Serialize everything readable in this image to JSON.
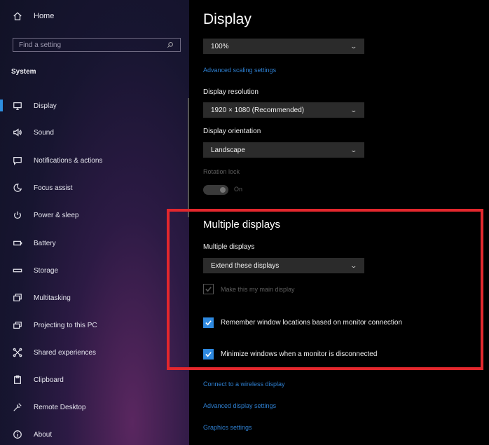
{
  "sidebar": {
    "home_label": "Home",
    "search_placeholder": "Find a setting",
    "section_title": "System",
    "items": [
      {
        "label": "Display",
        "icon": "monitor-icon"
      },
      {
        "label": "Sound",
        "icon": "speaker-icon"
      },
      {
        "label": "Notifications & actions",
        "icon": "message-icon"
      },
      {
        "label": "Focus assist",
        "icon": "moon-icon"
      },
      {
        "label": "Power & sleep",
        "icon": "power-icon"
      },
      {
        "label": "Battery",
        "icon": "battery-icon"
      },
      {
        "label": "Storage",
        "icon": "storage-icon"
      },
      {
        "label": "Multitasking",
        "icon": "multitasking-icon"
      },
      {
        "label": "Projecting to this PC",
        "icon": "projecting-icon"
      },
      {
        "label": "Shared experiences",
        "icon": "shared-icon"
      },
      {
        "label": "Clipboard",
        "icon": "clipboard-icon"
      },
      {
        "label": "Remote Desktop",
        "icon": "remote-desktop-icon"
      },
      {
        "label": "About",
        "icon": "info-icon"
      }
    ],
    "active_index": 0,
    "accent_color": "#2e8fe0"
  },
  "main": {
    "title": "Display",
    "scale_value": "100%",
    "advanced_scaling_link": "Advanced scaling settings",
    "resolution_label": "Display resolution",
    "resolution_value": "1920 × 1080 (Recommended)",
    "orientation_label": "Display orientation",
    "orientation_value": "Landscape",
    "rotation_lock_label": "Rotation lock",
    "rotation_lock_state": "On",
    "multiple_heading": "Multiple displays",
    "multiple_label": "Multiple displays",
    "multiple_value": "Extend these displays",
    "main_display_checkbox": "Make this my main display",
    "remember_checkbox": "Remember window locations based on monitor connection",
    "minimize_checkbox": "Minimize windows when a monitor is disconnected",
    "wireless_link": "Connect to a wireless display",
    "advanced_display_link": "Advanced display settings",
    "graphics_link": "Graphics settings",
    "link_color": "#2e7fd0",
    "highlight_color": "#e3272d"
  }
}
